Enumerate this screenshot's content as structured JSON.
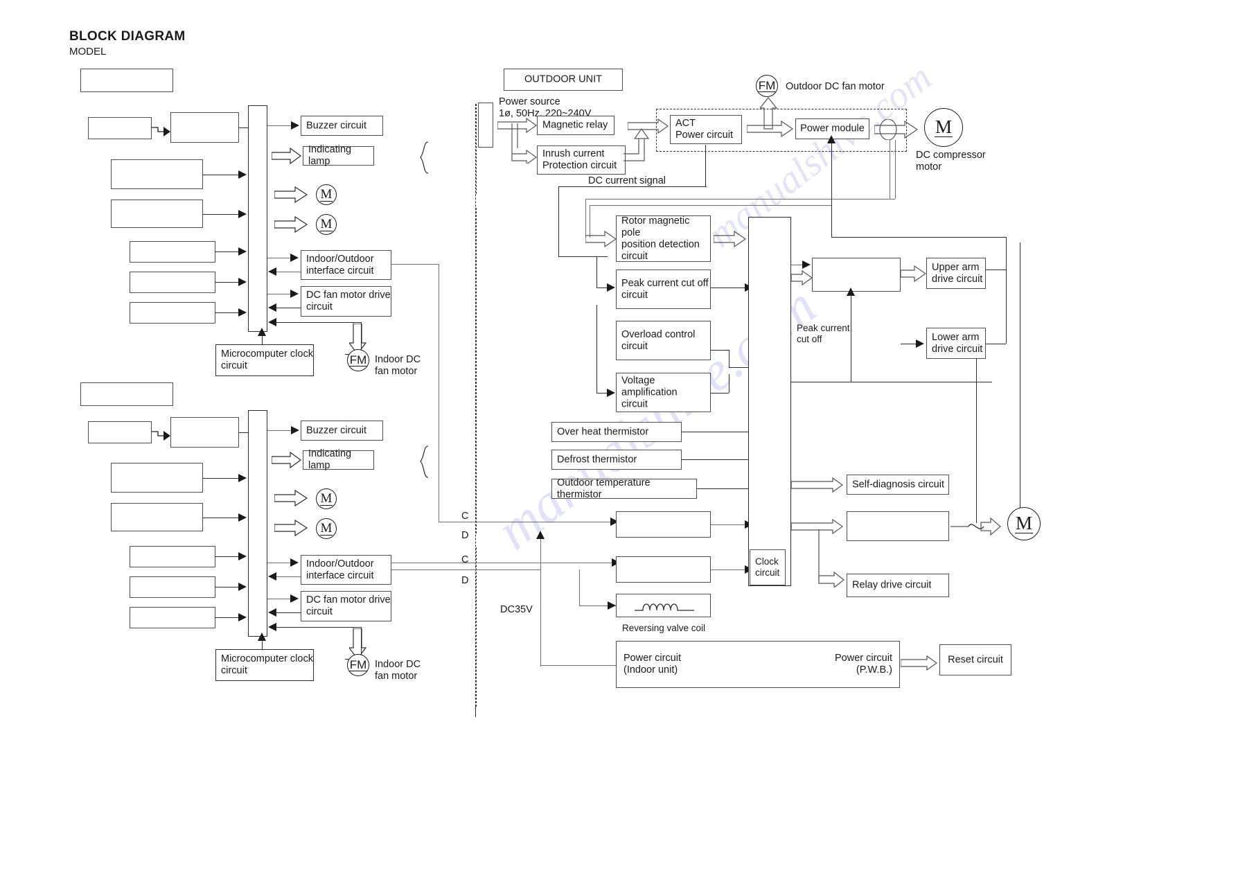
{
  "page": {
    "title": "BLOCK DIAGRAM",
    "model_label": "MODEL"
  },
  "indoor_unit_top": {
    "blank_model_box": "",
    "blank_boxes": [
      "",
      "",
      "",
      "",
      "",
      "",
      "",
      ""
    ],
    "buzzer_circuit": "Buzzer circuit",
    "indicating_lamp": "Indicating lamp",
    "motor_symbol": "M",
    "interface_circuit": "Indoor/Outdoor\ninterface circuit",
    "fan_drive_circuit": "DC fan motor drive\ncircuit",
    "microcomputer_clock": "Microcomputer clock\ncircuit",
    "fan_motor_symbol": "FM",
    "fan_motor_label": "Indoor DC\nfan motor"
  },
  "indoor_unit_bottom": {
    "blank_model_box": "",
    "blank_boxes": [
      "",
      "",
      "",
      "",
      "",
      "",
      "",
      ""
    ],
    "buzzer_circuit": "Buzzer circuit",
    "indicating_lamp": "Indicating lamp",
    "motor_symbol": "M",
    "interface_circuit": "Indoor/Outdoor\ninterface circuit",
    "fan_drive_circuit": "DC fan motor drive\ncircuit",
    "microcomputer_clock": "Microcomputer clock\ncircuit",
    "fan_motor_symbol": "FM",
    "fan_motor_label": "Indoor DC\nfan motor"
  },
  "bus_labels": {
    "c_top": "C",
    "d_top": "D",
    "c_bottom": "C",
    "d_bottom": "D",
    "dc35v": "DC35V"
  },
  "outdoor_unit": {
    "header": "OUTDOOR UNIT",
    "power_source": "Power source\n1ø, 50Hz, 220~240V",
    "magnetic_relay": "Magnetic relay",
    "inrush_current": "Inrush current\nProtection circuit",
    "act_power_circuit": "ACT\nPower circuit",
    "power_module": "Power module",
    "outdoor_fan_symbol": "FM",
    "outdoor_fan_label": "Outdoor DC fan motor",
    "compressor_symbol": "M",
    "compressor_label": "DC compressor\nmotor",
    "dc_current_signal": "DC current signal",
    "rotor_detection": "Rotor magnetic pole\nposition detection\ncircuit",
    "peak_current_cutoff": "Peak current cut off\ncircuit",
    "overload_control": "Overload control\ncircuit",
    "voltage_amplification": "Voltage amplification\ncircuit",
    "over_heat_thermistor": "Over heat thermistor",
    "defrost_thermistor": "Defrost thermistor",
    "outdoor_temp_thermistor": "Outdoor temperature thermistor",
    "blank_micro_box": "",
    "blank_interface_box": "",
    "blank_driver_box": "",
    "blank_valve_box": "",
    "blank_relay_target_box": "",
    "peak_current_cut_off_note": "Peak current\ncut off",
    "upper_arm": "Upper arm\ndrive circuit",
    "lower_arm": "Lower arm\ndrive circuit",
    "self_diagnosis": "Self-diagnosis circuit",
    "relay_drive": "Relay drive circuit",
    "clock_circuit": "Clock\ncircuit",
    "reversing_valve_coil": "Reversing valve coil",
    "power_circuit_indoor": "Power circuit\n(Indoor unit)",
    "power_circuit_pwb": "Power circuit\n(P.W.B.)",
    "reset_circuit": "Reset circuit",
    "valve_motor_symbol": "M"
  },
  "watermark": {
    "line1": "manualshive.com"
  },
  "colors": {
    "line": "#2b2b2b",
    "line_gray": "#6e6e6e",
    "box_border": "#4d4d4d",
    "background": "#ffffff",
    "watermark": "#9aa0e8"
  }
}
